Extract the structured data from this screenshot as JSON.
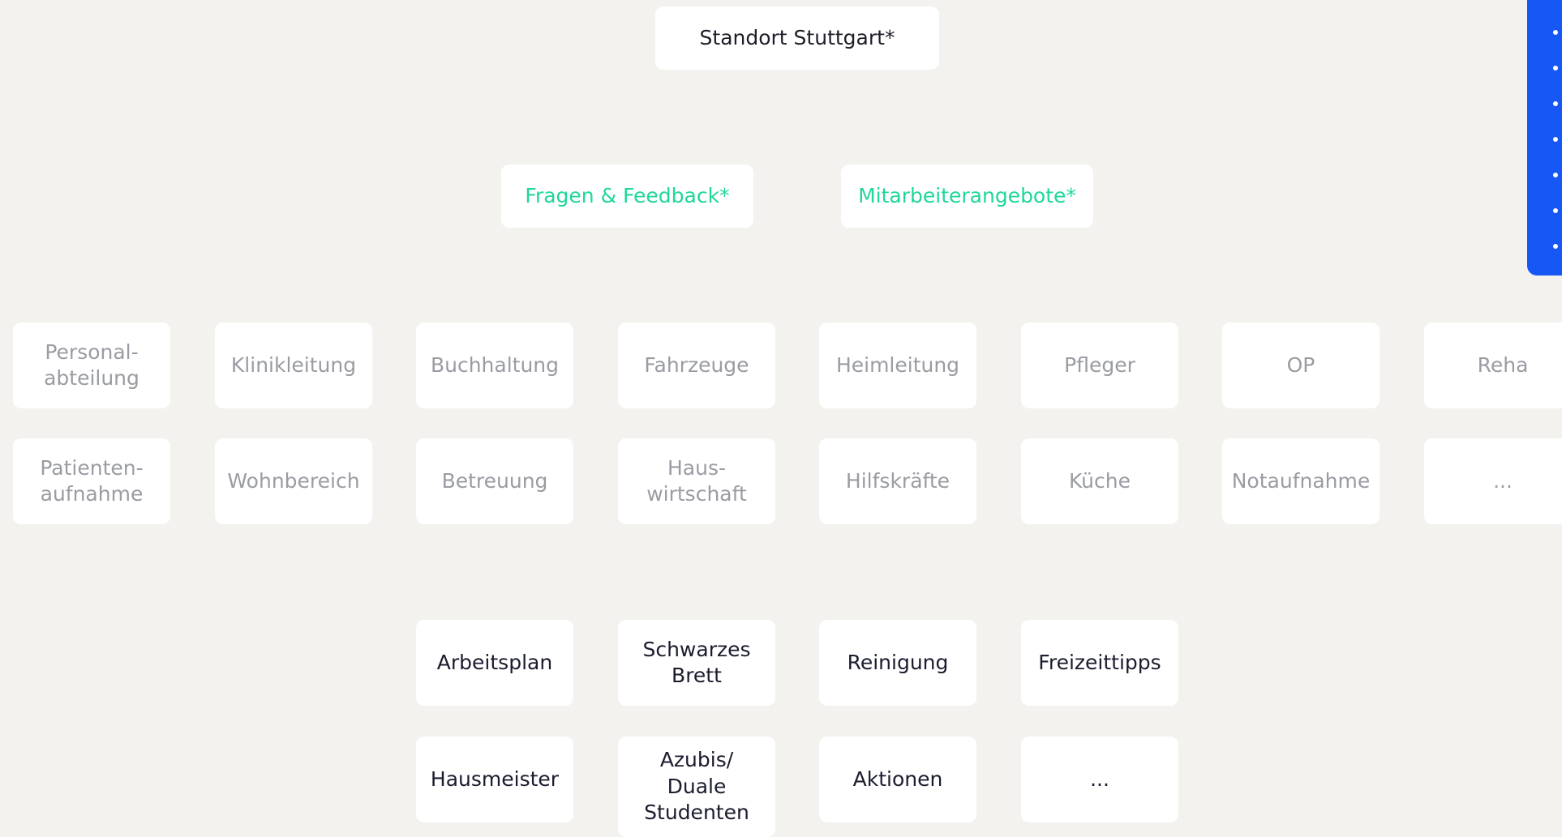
{
  "top": {
    "label": "Standort Stuttgart*"
  },
  "channels": [
    "Fragen & Feedback*",
    "Mitarbeiterangebote*"
  ],
  "departments": {
    "row1": [
      "Personal-\nabteilung",
      "Klinikleitung",
      "Buchhaltung",
      "Fahrzeuge",
      "Heimleitung",
      "Pfleger",
      "OP",
      "Reha"
    ],
    "row2": [
      "Patienten-\naufnahme",
      "Wohnbereich",
      "Betreuung",
      "Haus-\nwirtschaft",
      "Hilfskräfte",
      "Küche",
      "Notaufnahme",
      "..."
    ]
  },
  "topics": {
    "row1": [
      "Arbeitsplan",
      "Schwarzes\nBrett",
      "Reinigung",
      "Freizeittipps"
    ],
    "row2": [
      "Hausmeister",
      "Azubis/\nDuale\nStudenten",
      "Aktionen",
      "..."
    ]
  },
  "colors": {
    "background": "#f3f2ef",
    "card": "#ffffff",
    "accent_green": "#1fd79a",
    "accent_blue": "#1757f5",
    "muted_text": "#9a9ca3",
    "dark_text": "#1b1c2e"
  }
}
